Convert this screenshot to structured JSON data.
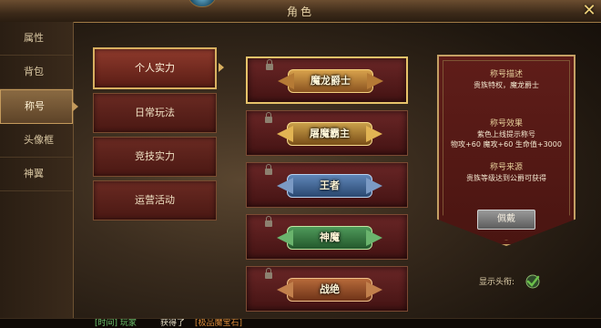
{
  "window": {
    "title": "角色"
  },
  "sidebar": {
    "items": [
      {
        "label": "属性"
      },
      {
        "label": "背包"
      },
      {
        "label": "称号"
      },
      {
        "label": "头像框"
      },
      {
        "label": "神翼"
      }
    ],
    "active_index": 2
  },
  "categories": [
    {
      "label": "个人实力"
    },
    {
      "label": "日常玩法"
    },
    {
      "label": "竞技实力"
    },
    {
      "label": "运营活动"
    }
  ],
  "titles": [
    {
      "label": "魔龙爵士"
    },
    {
      "label": "屠魔霸主"
    },
    {
      "label": "王者"
    },
    {
      "label": "神魔"
    },
    {
      "label": "战绝"
    }
  ],
  "detail": {
    "desc_head": "称号描述",
    "desc_text": "贵族特权，魔龙爵士",
    "effect_head": "称号效果",
    "effect_text_1": "紫色上线提示称号",
    "effect_text_2": "物攻+60 魔攻+60 生命值+3000",
    "source_head": "称号来源",
    "source_text": "贵族等级达到公爵可获得",
    "equip_label": "佩戴"
  },
  "show_head": {
    "label": "显示头衔:",
    "checked": true
  },
  "chat": {
    "part1": "[时间] 玩家",
    "part2": "获得了",
    "part3": "[极品魔宝石]"
  },
  "colors": {
    "accent_gold": "#e7c36a",
    "panel_red": "#5f1d19",
    "check_green": "#6cc04a"
  }
}
